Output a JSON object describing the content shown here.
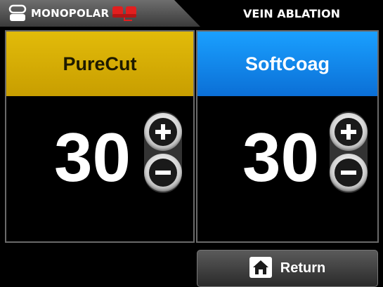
{
  "header": {
    "mode_label": "MONOPOLAR",
    "procedure_label": "VEIN ABLATION",
    "pedal_color": "#e11f1f"
  },
  "panels": [
    {
      "label": "PureCut",
      "value": "30",
      "color": "#d4aa00"
    },
    {
      "label": "SoftCoag",
      "value": "30",
      "color": "#0f86f0"
    }
  ],
  "footer": {
    "return_label": "Return",
    "return_icon": "home-icon"
  },
  "icons": {
    "mode_icon": "handpiece-icon",
    "pedal_icon": "foot-pedal-icon",
    "increase_icon": "plus-icon",
    "decrease_icon": "minus-icon"
  }
}
